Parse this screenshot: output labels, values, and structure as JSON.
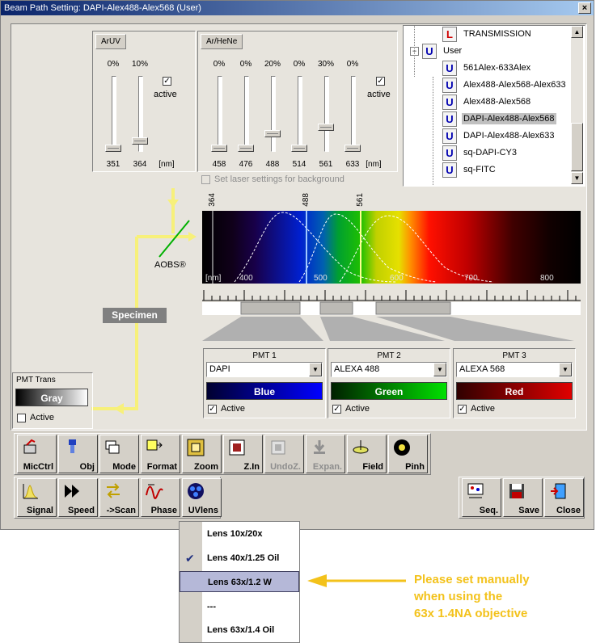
{
  "window": {
    "title": "Beam Path Setting:  DAPI-Alex488-Alex568  (User)",
    "close_glyph": "×"
  },
  "laser_uv": {
    "tab": "ArUV",
    "percents": [
      "0%",
      "10%"
    ],
    "wavelengths": [
      "351",
      "364"
    ],
    "unit": "[nm]",
    "active_label": "active",
    "levels": [
      0,
      0.1
    ]
  },
  "laser_arhene": {
    "tab": "Ar/HeNe",
    "percents": [
      "0%",
      "0%",
      "20%",
      "0%",
      "30%",
      "0%"
    ],
    "wavelengths": [
      "458",
      "476",
      "488",
      "514",
      "561",
      "633"
    ],
    "unit": "[nm]",
    "active_label": "active",
    "levels": [
      0,
      0,
      0.2,
      0,
      0.3,
      0
    ]
  },
  "background_checkbox": "Set laser settings for background",
  "tree": {
    "items": [
      {
        "badge": "L",
        "label": "TRANSMISSION",
        "level": 2,
        "color": "#d00000"
      },
      {
        "badge": "U",
        "label": "User",
        "level": 1,
        "expander": "−",
        "color": "#0000b0"
      },
      {
        "badge": "U",
        "label": "561Alex-633Alex",
        "level": 2,
        "color": "#0000b0"
      },
      {
        "badge": "U",
        "label": "Alex488-Alex568-Alex633",
        "level": 2,
        "color": "#0000b0"
      },
      {
        "badge": "U",
        "label": "Alex488-Alex568",
        "level": 2,
        "color": "#0000b0"
      },
      {
        "badge": "U",
        "label": "DAPI-Alex488-Alex568",
        "level": 2,
        "selected": true,
        "color": "#0000b0"
      },
      {
        "badge": "U",
        "label": "DAPI-Alex488-Alex633",
        "level": 2,
        "color": "#0000b0"
      },
      {
        "badge": "U",
        "label": "sq-DAPI-CY3",
        "level": 2,
        "color": "#0000b0"
      },
      {
        "badge": "U",
        "label": "sq-FITC",
        "level": 2,
        "color": "#0000b0"
      }
    ]
  },
  "spectrum": {
    "unit": "[nm]",
    "axis_labels": [
      "400",
      "500",
      "600",
      "700",
      "800"
    ],
    "laser_lines": [
      "364",
      "488",
      "561"
    ],
    "aobs_label": "AOBS®",
    "specimen_label": "Specimen"
  },
  "pmt_trans": {
    "title": "PMT Trans",
    "color_label": "Gray",
    "active_label": "Active"
  },
  "pmts": [
    {
      "title": "PMT 1",
      "dye": "DAPI",
      "color_label": "Blue",
      "active_label": "Active",
      "from": "#000030",
      "to": "#0000ff"
    },
    {
      "title": "PMT 2",
      "dye": "ALEXA 488",
      "color_label": "Green",
      "active_label": "Active",
      "from": "#002000",
      "to": "#00e000"
    },
    {
      "title": "PMT 3",
      "dye": "ALEXA 568",
      "color_label": "Red",
      "active_label": "Active",
      "from": "#300000",
      "to": "#e00000"
    }
  ],
  "toolbar1": [
    "MicCtrl",
    "Obj",
    "Mode",
    "Format",
    "Zoom",
    "Z.In",
    "UndoZ.",
    "Expan.",
    "Field",
    "Pinh"
  ],
  "toolbar2": [
    "Signal",
    "Speed",
    "->Scan",
    "Phase",
    "UVlens"
  ],
  "toolbar3": [
    "Seq.",
    "Save",
    "Close"
  ],
  "menu": {
    "items": [
      "Lens 10x/20x",
      "Lens 40x/1.25 Oil",
      "Lens 63x/1.2 W",
      "---",
      "Lens 63x/1.4 Oil"
    ],
    "checked_index": 1,
    "highlight_index": 2
  },
  "annotation": [
    "Please set manually",
    "when using the",
    "63x 1.4NA objective"
  ],
  "colors": {
    "annotation": "#f3c21b",
    "beam": "#f7f07a",
    "title_bar": "#0a246a"
  }
}
